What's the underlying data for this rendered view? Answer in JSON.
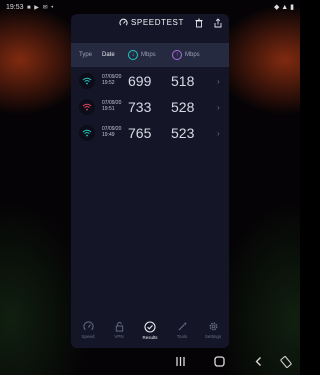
{
  "status_bar": {
    "time": "19:53",
    "left_icons": "■ ▶ ✉ •",
    "right_icons": "◆ ▲ ▮"
  },
  "app": {
    "title": "SPEEDTEST",
    "header": {
      "type": "Type",
      "date": "Date",
      "download_unit": "Mbps",
      "upload_unit": "Mbps"
    },
    "results": [
      {
        "date": "07/09/20",
        "time": "19:52",
        "download": "699",
        "upload": "518",
        "wifi_color": "#1ec8c0"
      },
      {
        "date": "07/09/20",
        "time": "19:51",
        "download": "733",
        "upload": "528",
        "wifi_color": "#e8445a"
      },
      {
        "date": "07/09/20",
        "time": "19:49",
        "download": "765",
        "upload": "523",
        "wifi_color": "#1ec8c0"
      }
    ],
    "bottom_nav": [
      {
        "label": "Speed",
        "icon": "speedometer-icon",
        "active": false
      },
      {
        "label": "VPN",
        "icon": "lock-icon",
        "active": false
      },
      {
        "label": "Results",
        "icon": "check-circle-icon",
        "active": true
      },
      {
        "label": "Tools",
        "icon": "wand-icon",
        "active": false
      },
      {
        "label": "Settings",
        "icon": "gear-icon",
        "active": false
      }
    ]
  },
  "colors": {
    "app_bg": "#141627",
    "header_bg": "#262a40",
    "download_accent": "#1ec8c0",
    "upload_accent": "#b06ae8"
  }
}
